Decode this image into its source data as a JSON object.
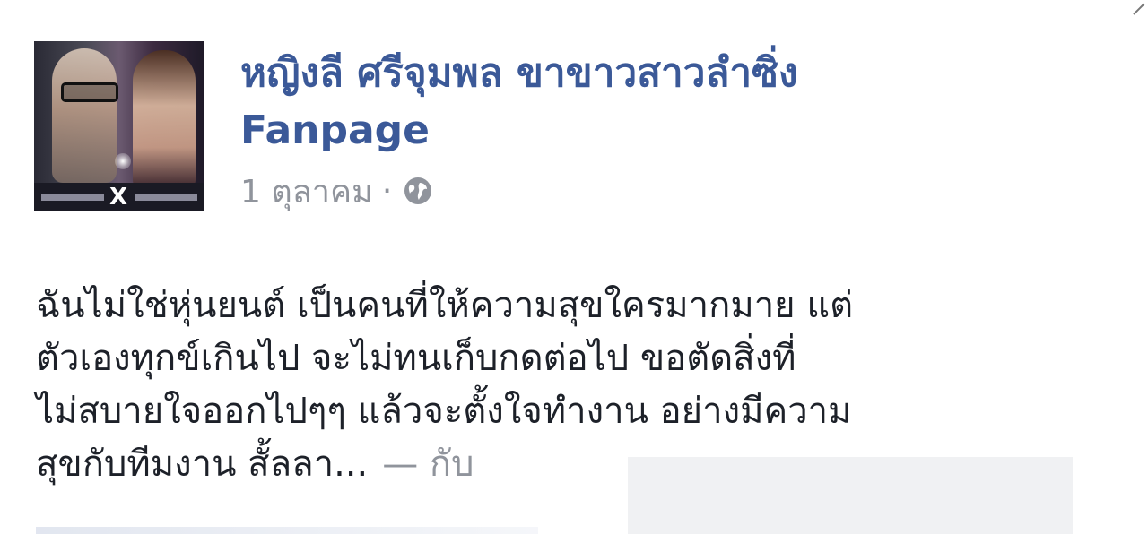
{
  "post": {
    "page_name_line1": "หญิงลี ศรีจุมพล ขาขาวสาวลำซิ่ง",
    "page_name_line2": "Fanpage",
    "date": "1 ตุลาคม",
    "separator": "·",
    "privacy_icon": "globe-icon",
    "body_lines": [
      "ฉันไม่ใช่หุ่นยนต์ เป็นคนที่ให้ความสุขใครมากมาย แต่",
      "ตัวเองทุกข์เกินไป จะไม่ทนเก็บกดต่อไป ขอตัดสิ่งที่",
      "ไม่สบายใจออกไปๆๆ แล้วจะตั้งใจทำงาน อย่างมีความ",
      "สุขกับทีมงาน สั้ลลา"
    ],
    "ellipsis": "...",
    "with_label": "— กับ"
  },
  "colors": {
    "link": "#3b5998",
    "meta": "#90949c",
    "text": "#1d2129",
    "redaction": "#f0f1f3"
  }
}
